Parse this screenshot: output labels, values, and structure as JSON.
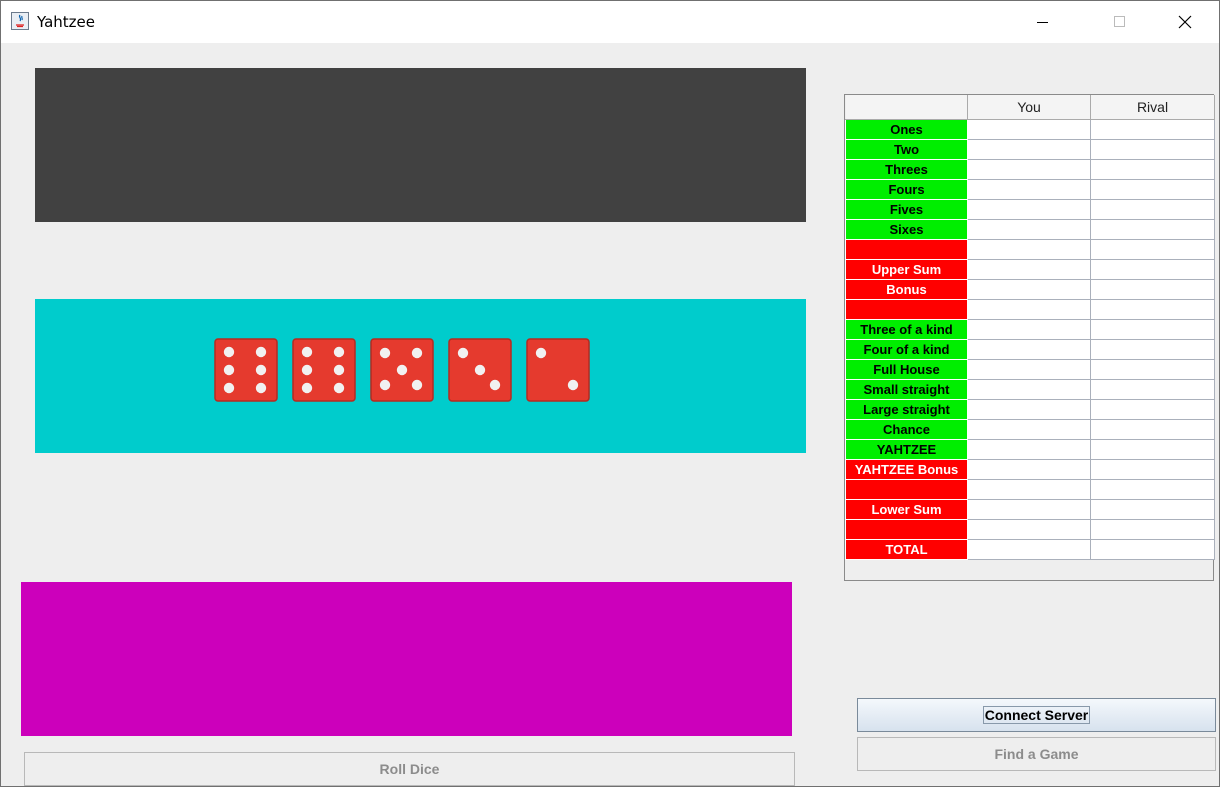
{
  "window": {
    "title": "Yahtzee"
  },
  "dice": [
    6,
    6,
    5,
    3,
    2
  ],
  "scorecard": {
    "headers": [
      "",
      "You",
      "Rival"
    ],
    "rows": [
      {
        "label": "Ones",
        "color": "#00ee00",
        "text_color": "#000000",
        "you": "",
        "rival": ""
      },
      {
        "label": "Two",
        "color": "#00ee00",
        "text_color": "#000000",
        "you": "",
        "rival": ""
      },
      {
        "label": "Threes",
        "color": "#00ee00",
        "text_color": "#000000",
        "you": "",
        "rival": ""
      },
      {
        "label": "Fours",
        "color": "#00ee00",
        "text_color": "#000000",
        "you": "",
        "rival": ""
      },
      {
        "label": "Fives",
        "color": "#00ee00",
        "text_color": "#000000",
        "you": "",
        "rival": ""
      },
      {
        "label": "Sixes",
        "color": "#00ee00",
        "text_color": "#000000",
        "you": "",
        "rival": ""
      },
      {
        "label": "",
        "color": "#ff0000",
        "text_color": "#ffffff",
        "you": "",
        "rival": ""
      },
      {
        "label": "Upper Sum",
        "color": "#ff0000",
        "text_color": "#ffffff",
        "you": "",
        "rival": ""
      },
      {
        "label": "Bonus",
        "color": "#ff0000",
        "text_color": "#ffffff",
        "you": "",
        "rival": ""
      },
      {
        "label": "",
        "color": "#ff0000",
        "text_color": "#ffffff",
        "you": "",
        "rival": ""
      },
      {
        "label": "Three of a kind",
        "color": "#00ee00",
        "text_color": "#000000",
        "you": "",
        "rival": ""
      },
      {
        "label": "Four of a kind",
        "color": "#00ee00",
        "text_color": "#000000",
        "you": "",
        "rival": ""
      },
      {
        "label": "Full House",
        "color": "#00ee00",
        "text_color": "#000000",
        "you": "",
        "rival": ""
      },
      {
        "label": "Small straight",
        "color": "#00ee00",
        "text_color": "#000000",
        "you": "",
        "rival": ""
      },
      {
        "label": "Large straight",
        "color": "#00ee00",
        "text_color": "#000000",
        "you": "",
        "rival": ""
      },
      {
        "label": "Chance",
        "color": "#00ee00",
        "text_color": "#000000",
        "you": "",
        "rival": ""
      },
      {
        "label": "YAHTZEE",
        "color": "#00ee00",
        "text_color": "#000000",
        "you": "",
        "rival": ""
      },
      {
        "label": "YAHTZEE Bonus",
        "color": "#ff0000",
        "text_color": "#ffffff",
        "you": "",
        "rival": ""
      },
      {
        "label": "",
        "color": "#ff0000",
        "text_color": "#ffffff",
        "you": "",
        "rival": ""
      },
      {
        "label": "Lower Sum",
        "color": "#ff0000",
        "text_color": "#ffffff",
        "you": "",
        "rival": ""
      },
      {
        "label": "",
        "color": "#ff0000",
        "text_color": "#ffffff",
        "you": "",
        "rival": ""
      },
      {
        "label": "TOTAL",
        "color": "#ff0000",
        "text_color": "#ffffff",
        "you": "",
        "rival": ""
      }
    ]
  },
  "buttons": {
    "roll": "Roll Dice",
    "connect": "Connect Server",
    "find": "Find a Game"
  },
  "colors": {
    "top_panel": "#414141",
    "dice_panel": "#00cccc",
    "bottom_panel": "#cc00bb",
    "die_face": "#e53a2e"
  }
}
